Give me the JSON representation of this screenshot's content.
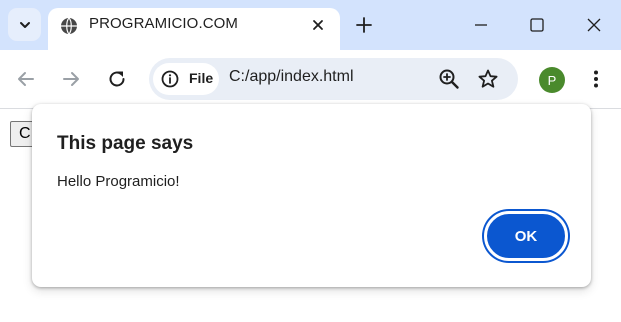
{
  "browser": {
    "tab": {
      "title": "PROGRAMICIO.COM"
    },
    "window_controls": [
      "minimize",
      "maximize",
      "close"
    ],
    "address_bar": {
      "chip_label": "File",
      "url": "C:/app/index.html"
    },
    "profile_initial": "P",
    "icons": [
      "tab-search-icon",
      "globe-icon",
      "close-icon",
      "plus-icon",
      "back-arrow-icon",
      "forward-arrow-icon",
      "reload-icon",
      "info-icon",
      "zoom-icon",
      "star-icon",
      "more-vert-icon"
    ]
  },
  "page": {
    "button_label": "C"
  },
  "dialog": {
    "title": "This page says",
    "message": "Hello Programicio!",
    "ok_label": "OK"
  },
  "colors": {
    "titlebar": "#d3e3fd",
    "omnibox": "#e9eef6",
    "accent": "#0b57d0",
    "avatar": "#4a8a2c"
  }
}
